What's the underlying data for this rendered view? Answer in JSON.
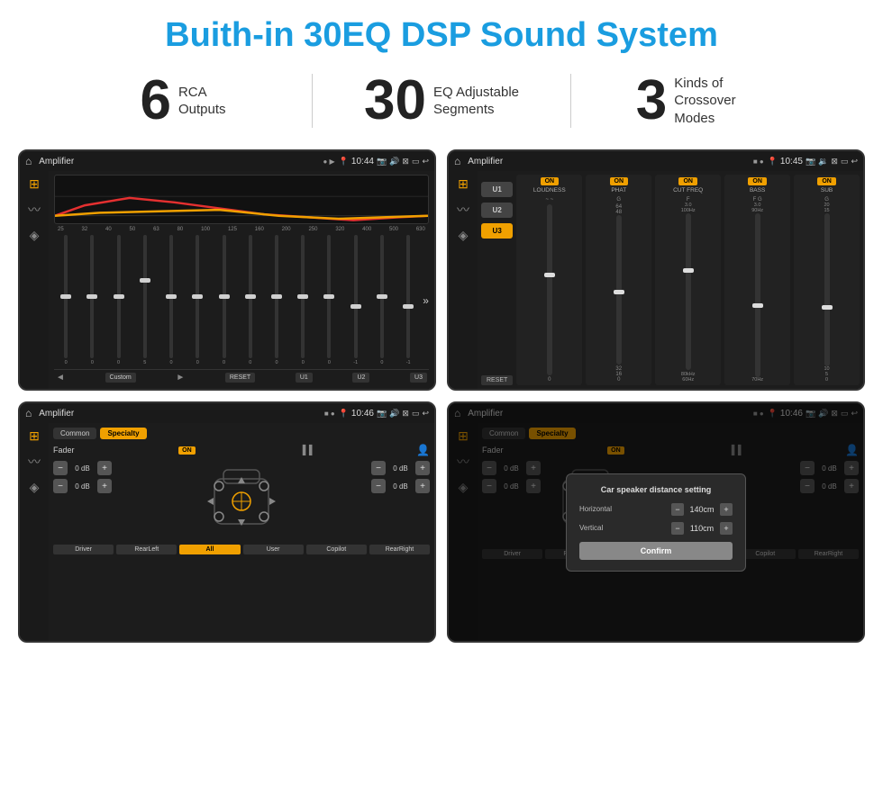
{
  "page": {
    "title": "Buith-in 30EQ DSP Sound System"
  },
  "stats": [
    {
      "number": "6",
      "label_line1": "RCA",
      "label_line2": "Outputs"
    },
    {
      "number": "30",
      "label_line1": "EQ Adjustable",
      "label_line2": "Segments"
    },
    {
      "number": "3",
      "label_line1": "Kinds of",
      "label_line2": "Crossover Modes"
    }
  ],
  "screens": {
    "eq": {
      "app_name": "Amplifier",
      "time": "10:44",
      "freq_labels": [
        "25",
        "32",
        "40",
        "50",
        "63",
        "80",
        "100",
        "125",
        "160",
        "200",
        "250",
        "320",
        "400",
        "500",
        "630"
      ],
      "slider_values": [
        "0",
        "0",
        "0",
        "5",
        "0",
        "0",
        "0",
        "0",
        "0",
        "0",
        "0",
        "-1",
        "0",
        "-1"
      ],
      "controls": [
        "◄",
        "Custom",
        "►",
        "RESET",
        "U1",
        "U2",
        "U3"
      ]
    },
    "crossover": {
      "app_name": "Amplifier",
      "time": "10:45",
      "presets": [
        "U1",
        "U2",
        "U3"
      ],
      "channels": [
        {
          "toggle": "ON",
          "name": "LOUDNESS"
        },
        {
          "toggle": "ON",
          "name": "PHAT"
        },
        {
          "toggle": "ON",
          "name": "CUT FREQ"
        },
        {
          "toggle": "ON",
          "name": "BASS"
        },
        {
          "toggle": "ON",
          "name": "SUB"
        }
      ],
      "reset_label": "RESET"
    },
    "fader": {
      "app_name": "Amplifier",
      "time": "10:46",
      "tabs": [
        "Common",
        "Specialty"
      ],
      "fader_label": "Fader",
      "on_badge": "ON",
      "sliders": [
        {
          "label": "0 dB"
        },
        {
          "label": "0 dB"
        },
        {
          "label": "0 dB"
        },
        {
          "label": "0 dB"
        }
      ],
      "positions": [
        "Driver",
        "RearLeft",
        "All",
        "User",
        "Copilot",
        "RearRight"
      ],
      "bottom_btns": [
        "Driver",
        "RearLeft",
        "All",
        "User",
        "Copilot",
        "RearRight"
      ]
    },
    "fader_dialog": {
      "app_name": "Amplifier",
      "time": "10:46",
      "tabs": [
        "Common",
        "Specialty"
      ],
      "dialog": {
        "title": "Car speaker distance setting",
        "horizontal_label": "Horizontal",
        "horizontal_value": "140cm",
        "vertical_label": "Vertical",
        "vertical_value": "110cm",
        "confirm_label": "Confirm"
      },
      "sliders": [
        {
          "label": "0 dB"
        },
        {
          "label": "0 dB"
        }
      ]
    }
  }
}
